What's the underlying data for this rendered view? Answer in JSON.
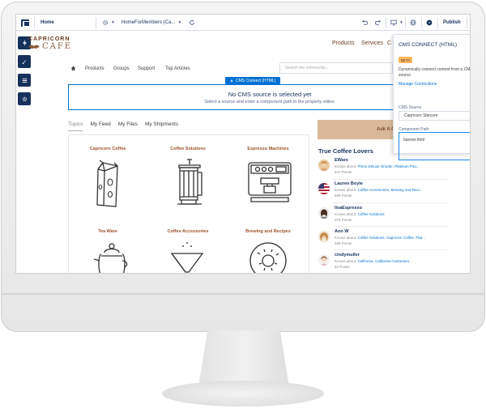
{
  "builder": {
    "page_select": "Home",
    "site_select": "HomeForMembers (Ca...",
    "publish_label": "Publish"
  },
  "site": {
    "brand_top": "CAPRICORN",
    "brand_bottom": "CAFE",
    "nav": [
      "Products",
      "Services",
      "C"
    ]
  },
  "community_nav": {
    "items": [
      "Products",
      "Groups",
      "Support",
      "Top Articles"
    ],
    "search_placeholder": "Search the community..."
  },
  "cms_component": {
    "tag": "CMS Connect (HTML)",
    "heading": "No CMS source is selected yet",
    "subtext": "Select a source and enter a component path in the property editor."
  },
  "tabs": [
    "Topics",
    "My Feed",
    "My Files",
    "My Shipments"
  ],
  "topics": [
    "Capricorn Coffee",
    "Coffee Solutions",
    "Espresso Machines",
    "Tea Ware",
    "Coffee Accessories",
    "Brewing and Recipes"
  ],
  "ask_button": "Ask A Question",
  "leaderboard": {
    "title": "True Coffee Lovers",
    "knows_label": "Knows about:",
    "members": [
      {
        "name": "EWare",
        "knows": "Primo Deluxe Grinder, Platinum Pou...",
        "points": "547 Points"
      },
      {
        "name": "Lauren Boyle",
        "knows": "Coffee Accessories, Brewing and Reci...",
        "points": "689 Points"
      },
      {
        "name": "lisaEspresso",
        "knows": "Coffee Solutions",
        "points": "378 Points"
      },
      {
        "name": "Ann W",
        "knows": "Coffee Solutions, Capricorn Coffee, Plat...",
        "points": "268 Points"
      },
      {
        "name": "cindymuller",
        "knows": "California, California Customers",
        "points": "52 Points"
      }
    ]
  },
  "panel": {
    "title": "CMS CONNECT (HTML)",
    "beta": "BETA",
    "description": "Dynamically connect content from a CMS source.",
    "manage_link": "Manage Connections",
    "source_label": "CMS Source",
    "source_value": "Capricorn Sitecore",
    "path_label": "Component Path",
    "path_value": "banner.html"
  },
  "colors": {
    "builder_navy": "#16325c",
    "accent_blue": "#0070d2",
    "brand_brown": "#a0522d",
    "ask_button": "#d9b99a"
  }
}
